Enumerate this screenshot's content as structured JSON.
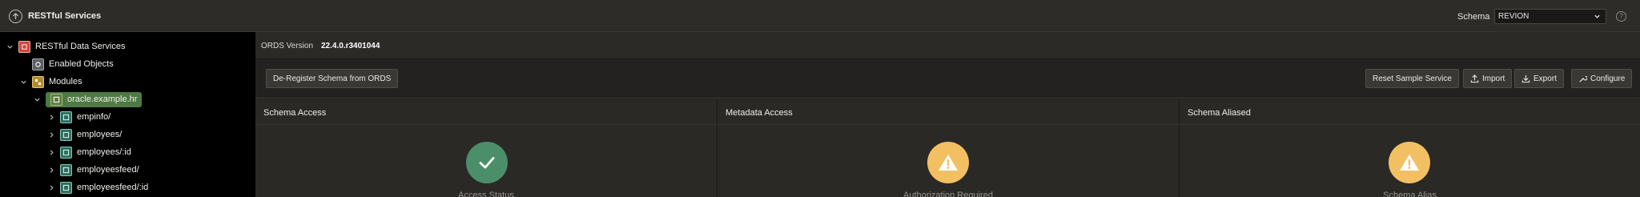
{
  "header": {
    "title": "RESTful Services",
    "schema_label": "Schema",
    "schema_value": "REVION"
  },
  "tree": {
    "root": "RESTful Data Services",
    "enabled_objects": "Enabled Objects",
    "modules": "Modules",
    "module": "oracle.example.hr",
    "templates": [
      "empinfo/",
      "employees/",
      "employees/:id",
      "employeesfeed/",
      "employeesfeed/:id"
    ]
  },
  "ords": {
    "version_label": "ORDS Version",
    "version_value": "22.4.0.r3401044"
  },
  "actions": {
    "deregister": "De-Register Schema from ORDS",
    "reset": "Reset Sample Service",
    "import": "Import",
    "export": "Export",
    "configure": "Configure"
  },
  "panels": [
    {
      "title": "Schema Access",
      "status": "Access Status"
    },
    {
      "title": "Metadata Access",
      "status": "Authorization Required"
    },
    {
      "title": "Schema Aliased",
      "status": "Schema Alias"
    }
  ],
  "colors": {
    "ok": "#4b8f6a",
    "warn": "#f2c063",
    "selected": "#4e7a44"
  },
  "icons": {
    "up": "arrow-up-circle-icon",
    "help": "help-icon",
    "ok": "checkmark-icon",
    "warn": "warning-icon"
  }
}
